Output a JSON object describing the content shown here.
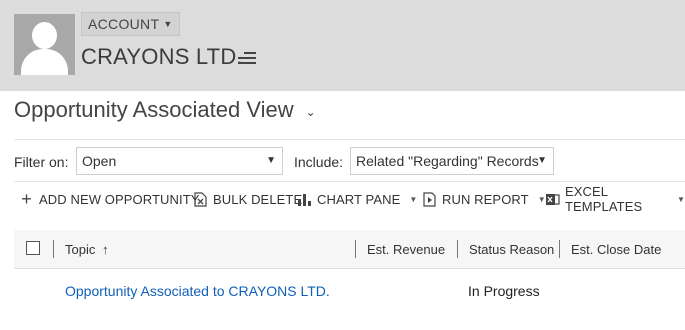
{
  "header": {
    "entity_type": "ACCOUNT",
    "record_name": "CRAYONS LTD."
  },
  "view": {
    "title": "Opportunity Associated View"
  },
  "filters": {
    "filter_on_label": "Filter on:",
    "filter_on_value": "Open",
    "include_label": "Include:",
    "include_value": "Related \"Regarding\" Records"
  },
  "commands": [
    {
      "label": "ADD NEW OPPORTUNITY",
      "icon": "plus-icon"
    },
    {
      "label": "BULK DELETE",
      "icon": "bulk-delete-icon"
    },
    {
      "label": "CHART PANE",
      "icon": "chart-icon"
    },
    {
      "label": "RUN REPORT",
      "icon": "report-icon"
    },
    {
      "label": "EXCEL TEMPLATES",
      "icon": "excel-icon"
    }
  ],
  "grid": {
    "columns": [
      "Topic",
      "Est. Revenue",
      "Status Reason",
      "Est. Close Date"
    ],
    "sort_indicator": "↑",
    "rows": [
      {
        "topic": "Opportunity Associated to CRAYONS LTD.",
        "est_revenue": "",
        "status_reason": "In Progress",
        "est_close_date": ""
      }
    ]
  },
  "colors": {
    "header_bg": "#dcdcdc",
    "link": "#1160b7"
  }
}
